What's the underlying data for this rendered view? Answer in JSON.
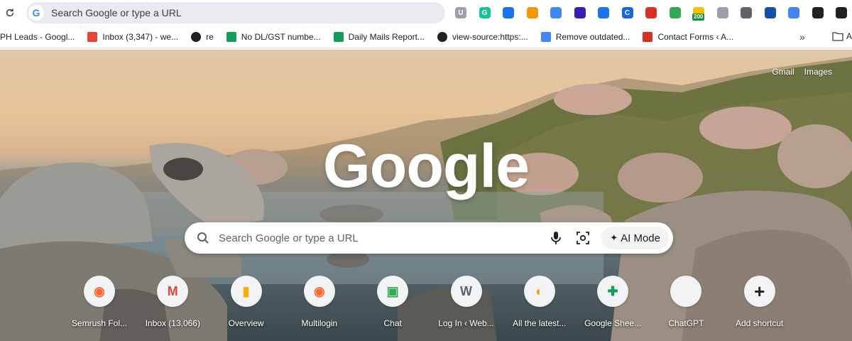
{
  "toolbar": {
    "omnibox_text": "Search Google or type a URL",
    "extensions": [
      {
        "icon": "u-icon",
        "label": "U",
        "color": "#9aa0a6"
      },
      {
        "icon": "grammarly-icon",
        "label": "G",
        "color": "#15c39a"
      },
      {
        "icon": "chart-ext-icon",
        "label": "",
        "color": "#1a73e8"
      },
      {
        "icon": "gear-sun-icon",
        "label": "",
        "color": "#f29900"
      },
      {
        "icon": "tag-icon",
        "label": "",
        "color": "#4285f4"
      },
      {
        "icon": "diamond-icon",
        "label": "",
        "color": "#3c1cb5"
      },
      {
        "icon": "cog-icon",
        "label": "",
        "color": "#1a73e8"
      },
      {
        "icon": "copyright-icon",
        "label": "C",
        "color": "#1967d2"
      },
      {
        "icon": "semrush-ext-icon",
        "label": "",
        "color": "#d93025"
      },
      {
        "icon": "leaf-icon",
        "label": "",
        "color": "#34a853"
      },
      {
        "icon": "badge-ext-icon",
        "label": "",
        "color": "#fbbc04",
        "badge": "200"
      },
      {
        "icon": "globe-icon",
        "label": "",
        "color": "#9aa0a6"
      },
      {
        "icon": "doc-icon",
        "label": "",
        "color": "#5f6368"
      },
      {
        "icon": "flag-icon",
        "label": "",
        "color": "#174ea6"
      },
      {
        "icon": "link-icon",
        "label": "",
        "color": "#4285f4"
      },
      {
        "icon": "puzzle-icon",
        "label": "",
        "color": "#202124"
      },
      {
        "icon": "download-icon",
        "label": "",
        "color": "#202124"
      }
    ]
  },
  "bookmarks": {
    "items": [
      {
        "label": "PH Leads - Googl...",
        "icon": "none"
      },
      {
        "label": "Inbox (3,347) - we...",
        "icon": "gmail-icon"
      },
      {
        "label": "re",
        "icon": "globe-icon"
      },
      {
        "label": "No DL/GST numbe...",
        "icon": "sheets-icon"
      },
      {
        "label": "Daily Mails Report...",
        "icon": "sheets-icon"
      },
      {
        "label": "view-source:https:...",
        "icon": "globe-icon"
      },
      {
        "label": "Remove outdated...",
        "icon": "google-icon"
      },
      {
        "label": "Contact Forms ‹ A...",
        "icon": "check-icon"
      }
    ],
    "more": "»",
    "folder_label": "A"
  },
  "ntp": {
    "top_links": {
      "gmail": "Gmail",
      "images": "Images"
    },
    "logo": "Google",
    "search_placeholder": "Search Google or type a URL",
    "ai_mode": "AI Mode",
    "shortcuts": [
      {
        "label": "Semrush Fol...",
        "icon": "semrush-icon",
        "glyph": "◉",
        "color": "#ff642d"
      },
      {
        "label": "Inbox (13,066)",
        "icon": "gmail-icon",
        "glyph": "M",
        "color": "#ea4335"
      },
      {
        "label": "Overview",
        "icon": "analytics-icon",
        "glyph": "▮",
        "color": "#f9ab00"
      },
      {
        "label": "Multilogin",
        "icon": "semrush-icon",
        "glyph": "◉",
        "color": "#ff642d"
      },
      {
        "label": "Chat",
        "icon": "google-chat-icon",
        "glyph": "▣",
        "color": "#34a853"
      },
      {
        "label": "Log In ‹ Web...",
        "icon": "wordpress-icon",
        "glyph": "W",
        "color": "#5f6368"
      },
      {
        "label": "All the latest...",
        "icon": "news-icon",
        "glyph": "◐",
        "color": "#f29900"
      },
      {
        "label": "Google Shee...",
        "icon": "sheets-icon",
        "glyph": "✚",
        "color": "#0f9d58"
      },
      {
        "label": "ChatGPT",
        "icon": "chatgpt-icon",
        "glyph": "",
        "color": "#ececec"
      },
      {
        "label": "Add shortcut",
        "icon": "plus-icon",
        "glyph": "+",
        "color": "#202124"
      }
    ]
  }
}
